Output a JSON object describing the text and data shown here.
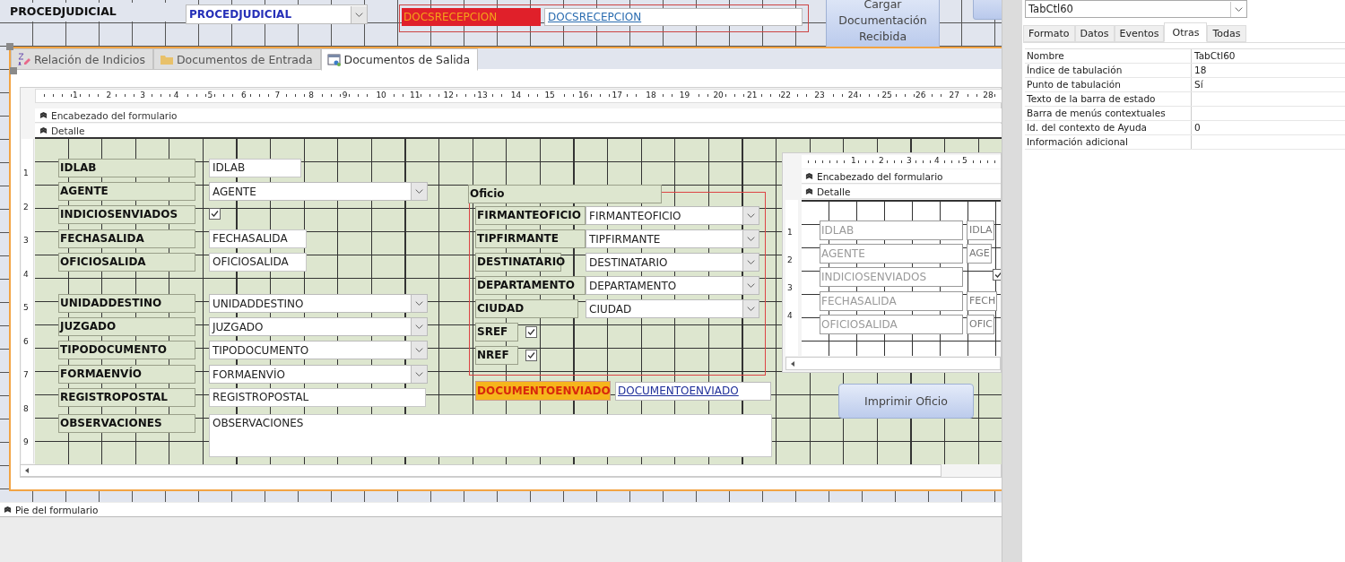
{
  "header": {
    "label": "PROCEDJUDICIAL",
    "combo": "PROCEDJUDICIAL",
    "docs_label": "DOCSRECEPCION",
    "docs_link": "DOCSRECEPCION",
    "load_button": "Cargar Documentación Recibida"
  },
  "tabs": [
    {
      "label": "Relación de Indicios",
      "selected": false
    },
    {
      "label": "Documentos de Entrada",
      "selected": false
    },
    {
      "label": "Documentos de Salida",
      "selected": true
    }
  ],
  "designer": {
    "ruler": [
      "1",
      "2",
      "3",
      "4",
      "5",
      "6",
      "7",
      "8",
      "9",
      "10",
      "11",
      "12",
      "13",
      "14",
      "15",
      "16",
      "17",
      "18",
      "19",
      "20",
      "21",
      "22",
      "23",
      "24",
      "25",
      "26",
      "27",
      "28"
    ],
    "vruler": [
      "1",
      "2",
      "3",
      "4",
      "5",
      "6",
      "7",
      "8",
      "9"
    ],
    "sections": [
      "Encabezado del formulario",
      "Detalle"
    ],
    "controls": [
      {
        "label": "IDLAB",
        "kind": "text",
        "value": "IDLAB"
      },
      {
        "label": "AGENTE",
        "kind": "combo",
        "value": "AGENTE"
      },
      {
        "label": "INDICIOSENVIADOS",
        "kind": "check",
        "checked": true
      },
      {
        "label": "FECHASALIDA",
        "kind": "text",
        "value": "FECHASALIDA"
      },
      {
        "label": "OFICIOSALIDA",
        "kind": "text",
        "value": "OFICIOSALIDA"
      },
      {
        "label": "UNIDADDESTINO",
        "kind": "combo",
        "value": "UNIDADDESTINO"
      },
      {
        "label": "JUZGADO",
        "kind": "combo",
        "value": "JUZGADO"
      },
      {
        "label": "TIPODOCUMENTO",
        "kind": "combo",
        "value": "TIPODOCUMENTO"
      },
      {
        "label": "FORMAENVÍO",
        "kind": "combo",
        "value": "FORMAENVÍO"
      },
      {
        "label": "REGISTROPOSTAL",
        "kind": "text",
        "value": "REGISTROPOSTAL"
      },
      {
        "label": "OBSERVACIONES",
        "kind": "memo",
        "value": "OBSERVACIONES"
      }
    ],
    "oficio": {
      "title": "Oficio",
      "controls": [
        {
          "label": "FIRMANTEOFICIO",
          "kind": "combo",
          "value": "FIRMANTEOFICIO"
        },
        {
          "label": "TIPFIRMANTE",
          "kind": "combo",
          "value": "TIPFIRMANTE"
        },
        {
          "label": "DESTINATARIO",
          "kind": "combo",
          "value": "DESTINATARIO"
        },
        {
          "label": "DEPARTAMENTO",
          "kind": "combo",
          "value": "DEPARTAMENTO"
        },
        {
          "label": "CIUDAD",
          "kind": "combo",
          "value": "CIUDAD"
        },
        {
          "label": "SREF",
          "kind": "check",
          "checked": true
        },
        {
          "label": "NREF",
          "kind": "check",
          "checked": true
        }
      ]
    },
    "document_sent": {
      "label": "DOCUMENTOENVIADO",
      "link": "DOCUMENTOENVIADO"
    },
    "print_button": "Imprimir Oficio",
    "subform": {
      "ruler": [
        "1",
        "2",
        "3",
        "4",
        "5"
      ],
      "vruler": [
        "1",
        "2",
        "3",
        "4"
      ],
      "sections": [
        "Encabezado del formulario",
        "Detalle"
      ],
      "controls": [
        {
          "label": "IDLAB",
          "kind": "text",
          "value": "IDLA"
        },
        {
          "label": "AGENTE",
          "kind": "text",
          "value": "AGE"
        },
        {
          "label": "INDICIOSENVIADOS",
          "kind": "check",
          "checked": true
        },
        {
          "label": "FECHASALIDA",
          "kind": "text",
          "value": "FECH"
        },
        {
          "label": "OFICIOSALIDA",
          "kind": "text",
          "value": "OFIC"
        }
      ]
    }
  },
  "footer_section": "Pie del formulario",
  "property_sheet": {
    "selector": "TabCtl60",
    "tabs": [
      {
        "label": "Formato",
        "selected": false
      },
      {
        "label": "Datos",
        "selected": false
      },
      {
        "label": "Eventos",
        "selected": false
      },
      {
        "label": "Otras",
        "selected": true
      },
      {
        "label": "Todas",
        "selected": false
      }
    ],
    "rows": [
      {
        "name": "Nombre",
        "value": "TabCtl60"
      },
      {
        "name": "Índice de tabulación",
        "value": "18"
      },
      {
        "name": "Punto de tabulación",
        "value": "Sí"
      },
      {
        "name": "Texto de la barra de estado"
      },
      {
        "name": "Barra de menús contextuales"
      },
      {
        "name": "Id. del contexto de Ayuda",
        "value": "0"
      },
      {
        "name": "Información adicional"
      }
    ]
  }
}
